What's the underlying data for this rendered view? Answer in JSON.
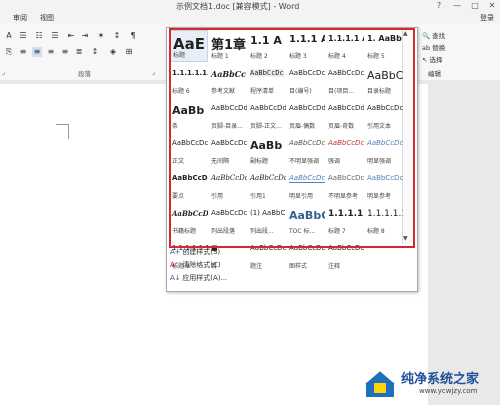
{
  "window": {
    "title": "示例文档1.doc [兼容模式] - Word",
    "help": "?",
    "minimize": "—",
    "maximize": "□",
    "close": "✕"
  },
  "menu": {
    "items": [
      "审阅",
      "视图"
    ],
    "login": "登录"
  },
  "ribbon": {
    "group_paragraph": "段落",
    "group_edit": "编辑",
    "find": "查找",
    "replace": "替换",
    "select": "选择"
  },
  "gallery": {
    "styles": [
      {
        "sample": "AaE",
        "name": "标题"
      },
      {
        "sample": "第1章",
        "name": "标题 1"
      },
      {
        "sample": "1.1 A",
        "name": "标题 2"
      },
      {
        "sample": "1.1.1 A",
        "name": "标题 3"
      },
      {
        "sample": "1.1.1.1 A",
        "name": "标题 4"
      },
      {
        "sample": "1. AaBb",
        "name": "标题 5"
      },
      {
        "sample": "1.1.1.1.1.",
        "name": "标题 6"
      },
      {
        "sample": "AaBbCc",
        "name": "参考文献"
      },
      {
        "sample": "AaBbCcDc",
        "name": "程序清单"
      },
      {
        "sample": "AaBbCcDc",
        "name": "目(编号)"
      },
      {
        "sample": "AaBbCcDc",
        "name": "目(项目..."
      },
      {
        "sample": "AaBbC",
        "name": "目录标题"
      },
      {
        "sample": "AaBb",
        "name": "条"
      },
      {
        "sample": "AaBbCcDd",
        "name": "页脚-目录..."
      },
      {
        "sample": "AaBbCcDd",
        "name": "页脚-正文..."
      },
      {
        "sample": "AaBbCcDd",
        "name": "页眉-偶数"
      },
      {
        "sample": "AaBbCcDd",
        "name": "页眉-奇数"
      },
      {
        "sample": "AaBbCcDc",
        "name": "引用文本"
      },
      {
        "sample": "AaBbCcDc",
        "name": "正文"
      },
      {
        "sample": "AaBbCcDc",
        "name": "无间隔"
      },
      {
        "sample": "AaBb",
        "name": "副标题"
      },
      {
        "sample": "AaBbCcDc",
        "name": "不明显强调"
      },
      {
        "sample": "AaBbCcDc",
        "name": "强调"
      },
      {
        "sample": "AaBbCcDc",
        "name": "明显强调"
      },
      {
        "sample": "AaBbCcDd",
        "name": "要点"
      },
      {
        "sample": "AaBbCcDc",
        "name": "引用"
      },
      {
        "sample": "AaBbCcDc",
        "name": "引用1"
      },
      {
        "sample": "AaBbCcDc",
        "name": "明显引用"
      },
      {
        "sample": "AaBbCcDc",
        "name": "不明显参考"
      },
      {
        "sample": "AaBbCcDc",
        "name": "明显参考"
      },
      {
        "sample": "AaBbCcDc",
        "name": "书籍标题"
      },
      {
        "sample": "AaBbCcDc",
        "name": "列出段落"
      },
      {
        "sample": "(1) AaBbC",
        "name": "列出段..."
      },
      {
        "sample": "AaBbC",
        "name": "TOC 标..."
      },
      {
        "sample": "1.1.1.1.1.",
        "name": "标题 7"
      },
      {
        "sample": "1.1.1.1.1.",
        "name": "标题 8"
      },
      {
        "sample": "1.1.1.1.1.1",
        "name": "标题 9"
      },
      {
        "sample": "■",
        "name": "目"
      },
      {
        "sample": "AaBbCcDc",
        "name": "题注"
      },
      {
        "sample": "AaBbCcDc",
        "name": "图样式"
      },
      {
        "sample": "AaBbCcDc",
        "name": "注释"
      }
    ],
    "commands": [
      {
        "icon": "A+",
        "label": "创建样式(S)"
      },
      {
        "icon": "A⁄",
        "label": "清除格式(C)"
      },
      {
        "icon": "A↓",
        "label": "应用样式(A)..."
      }
    ]
  },
  "watermark": {
    "name": "纯净系统之家",
    "url": "www.ycwjzy.com"
  }
}
